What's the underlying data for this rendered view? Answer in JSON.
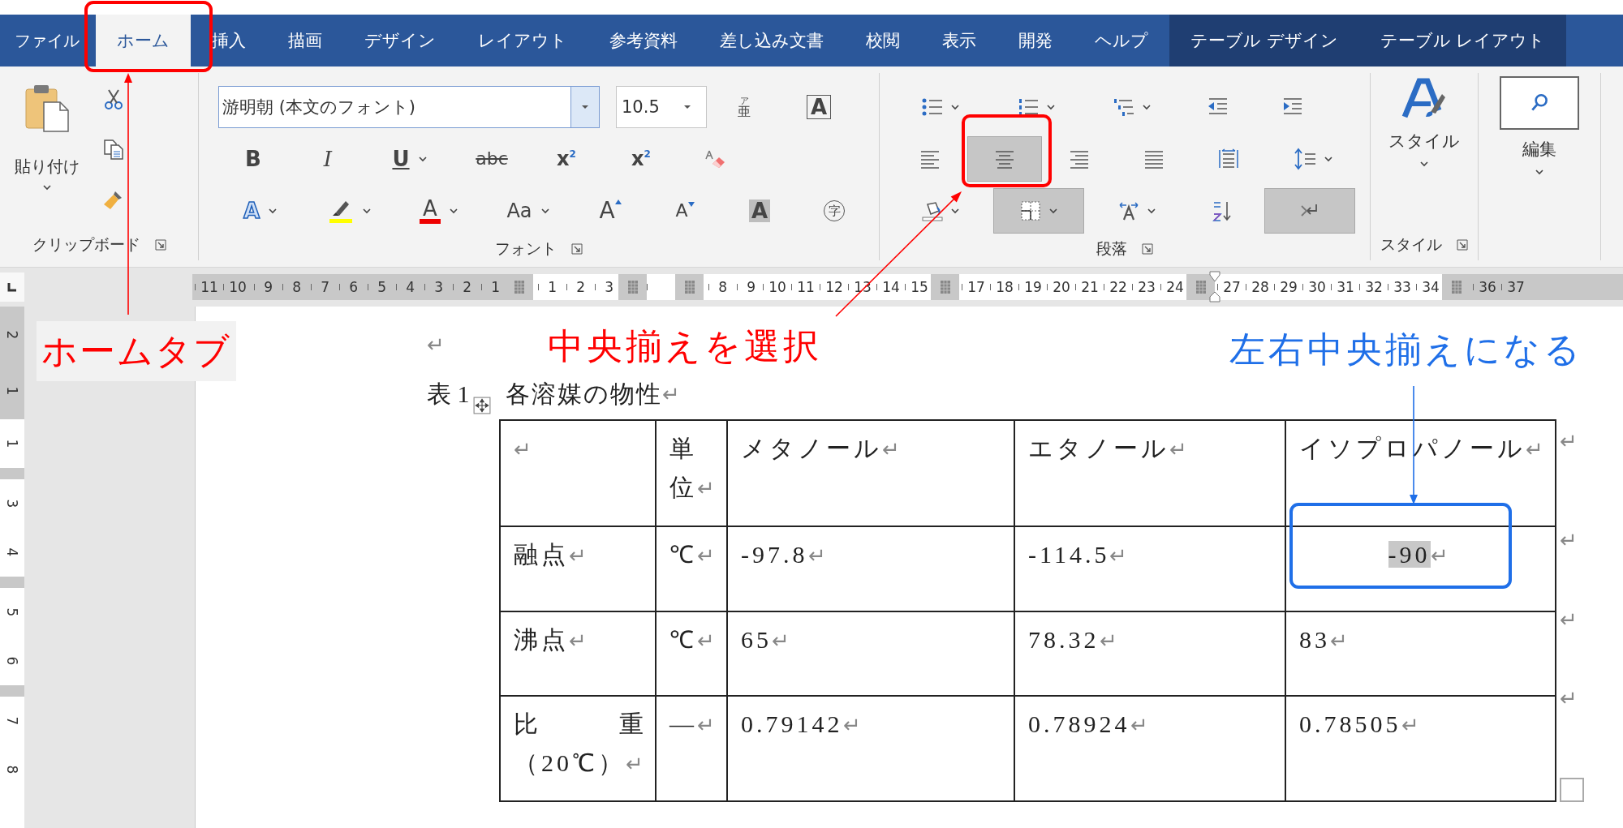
{
  "tabs": [
    {
      "label": "ファイル",
      "selected": false,
      "contextual": false
    },
    {
      "label": "ホーム",
      "selected": true,
      "contextual": false
    },
    {
      "label": "挿入",
      "selected": false,
      "contextual": false
    },
    {
      "label": "描画",
      "selected": false,
      "contextual": false
    },
    {
      "label": "デザイン",
      "selected": false,
      "contextual": false
    },
    {
      "label": "レイアウト",
      "selected": false,
      "contextual": false
    },
    {
      "label": "参考資料",
      "selected": false,
      "contextual": false
    },
    {
      "label": "差し込み文書",
      "selected": false,
      "contextual": false
    },
    {
      "label": "校閲",
      "selected": false,
      "contextual": false
    },
    {
      "label": "表示",
      "selected": false,
      "contextual": false
    },
    {
      "label": "開発",
      "selected": false,
      "contextual": false
    },
    {
      "label": "ヘルプ",
      "selected": false,
      "contextual": false
    },
    {
      "label": "テーブル デザイン",
      "selected": false,
      "contextual": true
    },
    {
      "label": "テーブル レイアウト",
      "selected": false,
      "contextual": true
    }
  ],
  "clipboard": {
    "paste_label": "貼り付け",
    "label": "クリップボード"
  },
  "font": {
    "name": "游明朝 (本文のフォント)",
    "size": "10.5",
    "label": "フォント",
    "rows": [
      [
        {
          "kind": "ruby",
          "glyph": "亜",
          "ruby": "ア",
          "dropdown": false
        },
        {
          "kind": "boxed",
          "glyph": "A",
          "dropdown": false
        }
      ],
      [
        {
          "kind": "bold",
          "glyph": "B",
          "dropdown": false
        },
        {
          "kind": "italic",
          "glyph": "I",
          "dropdown": false
        },
        {
          "kind": "underline",
          "glyph": "U",
          "dropdown": true
        },
        {
          "kind": "strike",
          "glyph": "abc",
          "dropdown": false
        },
        {
          "kind": "sub",
          "glyph": "x",
          "script": "2",
          "dropdown": false
        },
        {
          "kind": "sup",
          "glyph": "x",
          "script": "2",
          "dropdown": false
        },
        {
          "kind": "eraser",
          "dropdown": false
        }
      ],
      [
        {
          "kind": "effect",
          "glyph": "A",
          "dropdown": true
        },
        {
          "kind": "highlight",
          "dropdown": true
        },
        {
          "kind": "color",
          "glyph": "A",
          "dropdown": true
        },
        {
          "kind": "case",
          "glyph": "Aa",
          "dropdown": true
        },
        {
          "kind": "grow",
          "glyph": "A",
          "dropdown": false
        },
        {
          "kind": "shrink",
          "glyph": "A",
          "dropdown": false
        },
        {
          "kind": "shade",
          "glyph": "A",
          "dropdown": false
        },
        {
          "kind": "enclose",
          "glyph": "字",
          "dropdown": false
        }
      ]
    ]
  },
  "paragraph": {
    "label": "段落",
    "rows": [
      [
        {
          "kind": "bullets",
          "dropdown": true,
          "selected": false
        },
        {
          "kind": "numbering",
          "dropdown": true,
          "selected": false
        },
        {
          "kind": "multilevel",
          "dropdown": true,
          "selected": false
        },
        {
          "kind": "outdent",
          "dropdown": false,
          "selected": false
        },
        {
          "kind": "indent",
          "dropdown": false,
          "selected": false
        }
      ],
      [
        {
          "kind": "align-left",
          "dropdown": false,
          "selected": false
        },
        {
          "kind": "align-center",
          "dropdown": false,
          "selected": true
        },
        {
          "kind": "align-right",
          "dropdown": false,
          "selected": false
        },
        {
          "kind": "justify",
          "dropdown": false,
          "selected": false
        },
        {
          "kind": "distribute",
          "dropdown": false,
          "selected": false
        },
        {
          "kind": "spacing",
          "dropdown": true,
          "selected": false
        }
      ],
      [
        {
          "kind": "shading",
          "dropdown": true,
          "selected": false
        },
        {
          "kind": "borders",
          "dropdown": true,
          "selected": true
        },
        {
          "kind": "direction",
          "dropdown": true,
          "selected": false
        },
        {
          "kind": "sort",
          "dropdown": false,
          "selected": false
        },
        {
          "kind": "merge",
          "dropdown": false,
          "selected": true
        }
      ]
    ]
  },
  "styles": {
    "button_label": "スタイル",
    "label": "スタイル"
  },
  "editing": {
    "button_label": "編集"
  },
  "ruler": [
    {
      "kind": "margin",
      "labels": [
        "11",
        "10",
        "9",
        "8",
        "7",
        "6",
        "5",
        "4",
        "3",
        "2",
        "1"
      ]
    },
    {
      "kind": "boundary"
    },
    {
      "kind": "text",
      "labels": [
        "1",
        "2",
        "3"
      ]
    },
    {
      "kind": "boundary"
    },
    {
      "kind": "text"
    },
    {
      "kind": "boundary"
    },
    {
      "kind": "text",
      "labels": [
        "8",
        "9",
        "10",
        "11",
        "12",
        "13",
        "14",
        "15"
      ]
    },
    {
      "kind": "boundary"
    },
    {
      "kind": "text",
      "labels": [
        "17",
        "18",
        "19",
        "20",
        "21",
        "22",
        "23",
        "24"
      ]
    },
    {
      "kind": "indent"
    },
    {
      "kind": "text",
      "labels": [
        "27",
        "28",
        "29",
        "30",
        "31",
        "32",
        "33",
        "34"
      ]
    },
    {
      "kind": "boundary"
    },
    {
      "kind": "margin",
      "labels": [
        "36",
        "37"
      ]
    }
  ],
  "vruler": [
    {
      "kind": "margin",
      "labels": [
        "2",
        "1"
      ]
    },
    {
      "kind": "text",
      "labels": [
        "1"
      ]
    },
    {
      "kind": "boundary"
    },
    {
      "kind": "text",
      "labels": [
        "3",
        "4"
      ]
    },
    {
      "kind": "boundary"
    },
    {
      "kind": "text",
      "labels": [
        "5",
        "6"
      ]
    },
    {
      "kind": "boundary"
    },
    {
      "kind": "text",
      "labels": [
        "7",
        "8"
      ]
    }
  ],
  "annotations": [
    {
      "text": "ホームタブ",
      "color": "#ff0000"
    },
    {
      "text": "中央揃えを選択",
      "color": "#ff0000"
    },
    {
      "text": "左右中央揃えになる",
      "color": "#1f6fe8"
    }
  ],
  "document": {
    "empty_mark": "↵",
    "caption": {
      "label": "表 1",
      "title": "各溶媒の物性",
      "mark": "↵"
    },
    "table": {
      "rows": [
        {
          "end_mark": "↵",
          "cells": [
            {
              "mark": "↵",
              "centered": false,
              "highlighted": false
            },
            {
              "text": "単位",
              "mark": "↵",
              "centered": false,
              "highlighted": false
            },
            {
              "text": "メタノール",
              "mark": "↵",
              "centered": false,
              "highlighted": false
            },
            {
              "text": "エタノール",
              "mark": "↵",
              "centered": false,
              "highlighted": false
            },
            {
              "text": "イソプロパノール",
              "mark": "↵",
              "centered": false,
              "highlighted": false
            }
          ]
        },
        {
          "end_mark": "↵",
          "cells": [
            {
              "text": "融点",
              "mark": "↵",
              "centered": false,
              "highlighted": false
            },
            {
              "text": "℃",
              "mark": "↵",
              "centered": false,
              "highlighted": false
            },
            {
              "text": "-97.8",
              "mark": "↵",
              "centered": false,
              "highlighted": false
            },
            {
              "text": "-114.5",
              "mark": "↵",
              "centered": false,
              "highlighted": false
            },
            {
              "text": "-90",
              "mark": "↵",
              "centered": true,
              "highlighted": true
            }
          ]
        },
        {
          "end_mark": "↵",
          "cells": [
            {
              "text": "沸点",
              "mark": "↵",
              "centered": false,
              "highlighted": false
            },
            {
              "text": "℃",
              "mark": "↵",
              "centered": false,
              "highlighted": false
            },
            {
              "text": "65",
              "mark": "↵",
              "centered": false,
              "highlighted": false
            },
            {
              "text": "78.32",
              "mark": "↵",
              "centered": false,
              "highlighted": false
            },
            {
              "text": "83",
              "mark": "↵",
              "centered": false,
              "highlighted": false
            }
          ]
        },
        {
          "end_mark": "↵",
          "cells": [
            {
              "lines": [
                "比 重",
                "（20℃）"
              ],
              "mark": "↵",
              "centered": false,
              "highlighted": false
            },
            {
              "text": "—",
              "mark": "↵",
              "centered": false,
              "highlighted": false
            },
            {
              "text": "0.79142",
              "mark": "↵",
              "centered": false,
              "highlighted": false
            },
            {
              "text": "0.78924",
              "mark": "↵",
              "centered": false,
              "highlighted": false
            },
            {
              "text": "0.78505",
              "mark": "↵",
              "centered": false,
              "highlighted": false
            }
          ]
        }
      ]
    }
  }
}
